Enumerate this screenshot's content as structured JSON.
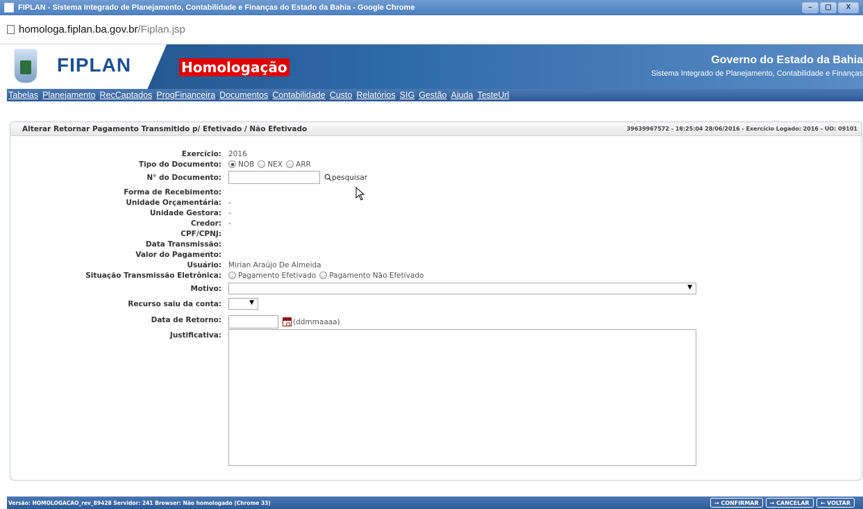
{
  "window": {
    "title": "FIPLAN - Sistema Integrado de Planejamento, Contabilidade e Finanças do Estado da Bahia - Google Chrome",
    "minimize": "–",
    "maximize": "▢",
    "close": "X"
  },
  "address": {
    "host": "homologa.fiplan.ba.gov.br",
    "path": "/Fiplan.jsp"
  },
  "banner": {
    "logo_text": "FIPLAN",
    "environment": "Homologação",
    "government": "Governo do Estado da Bahia",
    "system_name": "Sistema Integrado de Planejamento, Contabilidade e Finanças"
  },
  "menu": [
    "Tabelas",
    "Planejamento",
    "RecCaptados",
    "ProgFinanceira",
    "Documentos",
    "Contabilidade",
    "Custo",
    "Relatórios",
    "SIG",
    "Gestão",
    "Ajuda",
    "TesteUrl"
  ],
  "panel": {
    "title": "Alterar Retornar Pagamento Transmitido p/ Efetivado / Não Efetivado",
    "info": "39639967572 - 18:25:04 28/06/2016 - Exercício Logado: 2016 - UO: 09101"
  },
  "form": {
    "exercicio_label": "Exercício:",
    "exercicio_value": "2016",
    "tipo_label": "Tipo do Documento:",
    "tipo_options": [
      "NOB",
      "NEX",
      "ARR"
    ],
    "tipo_selected": "NOB",
    "numero_label": "N° do Documento:",
    "numero_value": "",
    "pesquisar_label": "pesquisar",
    "forma_label": "Forma de Recebimento:",
    "uo_label": "Unidade Orçamentária:",
    "uo_value": "-",
    "ug_label": "Unidade Gestora:",
    "ug_value": "-",
    "credor_label": "Credor:",
    "credor_value": "-",
    "cpf_label": "CPF/CPNJ:",
    "data_trans_label": "Data Transmissão:",
    "valor_label": "Valor do Pagamento:",
    "usuario_label": "Usuário:",
    "usuario_value": "Mirian Araújo De Almeida",
    "situacao_label": "Situação Transmissão Eletrônica:",
    "situacao_options": [
      "Pagamento Efetivado",
      "Pagamento Não Efetivado"
    ],
    "motivo_label": "Motivo:",
    "motivo_value": "",
    "recurso_label": "Recurso saiu da conta:",
    "recurso_value": "",
    "data_retorno_label": "Data de Retorno:",
    "data_retorno_value": "",
    "data_format_hint": "(ddmmaaaa)",
    "justificativa_label": "Justificativa:",
    "justificativa_value": ""
  },
  "footer": {
    "version": "Versão: HOMOLOGACAO_rev_89428  Servidor: 241  Browser: Não homologado (Chrome 33)",
    "confirmar": "→ CONFIRMAR",
    "cancelar": "→ CANCELAR",
    "voltar": "← VOLTAR"
  },
  "colors": {
    "menu_blue": "#2f5c98",
    "banner_blue": "#1f4e85",
    "homolog_red": "#e00000"
  }
}
